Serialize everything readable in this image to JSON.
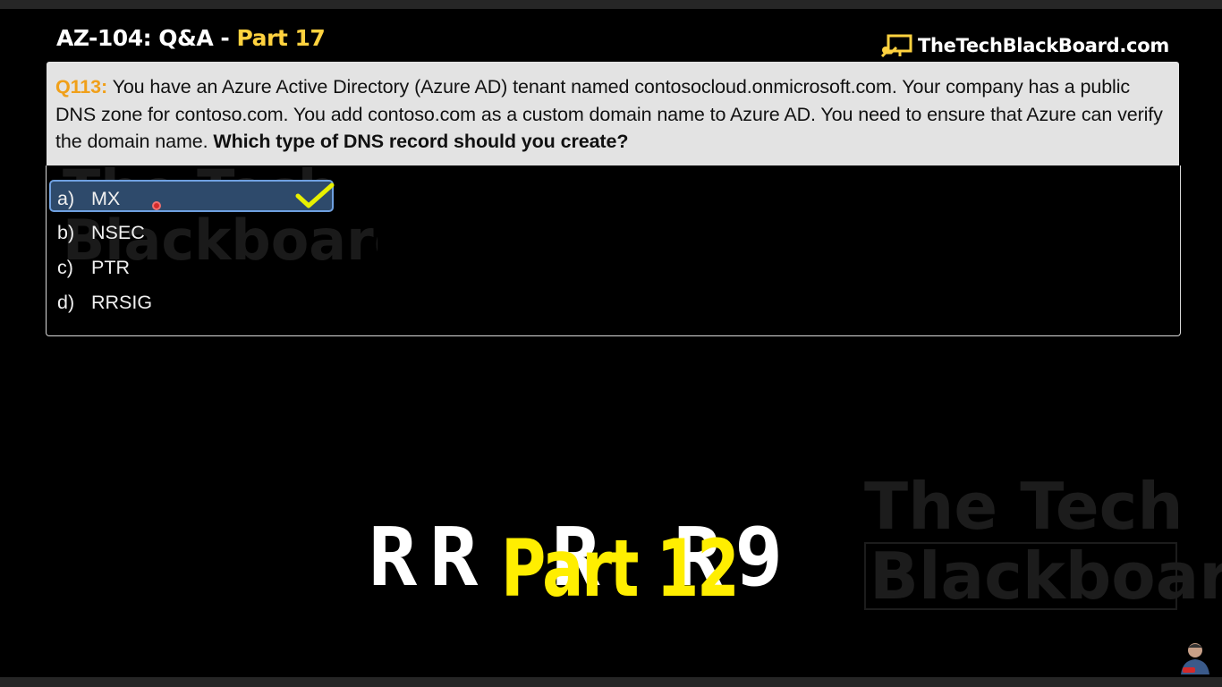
{
  "header": {
    "title_main": "AZ-104: Q&A",
    "title_sep": " - ",
    "title_part": "Part 17",
    "brand": "TheTechBlackBoard.com",
    "brand_icon": "chalkboard-icon"
  },
  "question": {
    "number": "Q113:",
    "text": " You have an Azure Active Directory (Azure AD) tenant named contosocloud.onmicrosoft.com. Your company has a public DNS zone for contoso.com. You add contoso.com as a custom domain name to Azure AD. You need to ensure that Azure can verify the domain name. ",
    "ask": "Which type of DNS record should you create?"
  },
  "options": [
    {
      "letter": "a)",
      "text": "MX",
      "selected": true
    },
    {
      "letter": "b)",
      "text": "NSEC",
      "selected": false
    },
    {
      "letter": "c)",
      "text": "PTR",
      "selected": false
    },
    {
      "letter": "d)",
      "text": "RRSIG",
      "selected": false
    }
  ],
  "watermark": {
    "line1": "The Tech",
    "line2": "Blackboard"
  },
  "overlay": {
    "glitch_text": "RR R R9",
    "part_label": "Part 12"
  },
  "colors": {
    "background": "#000000",
    "question_bg": "#e3e3e3",
    "question_number": "#f0a01a",
    "title_part": "#ffd23f",
    "selected_bg": "#2e4a6b",
    "check": "#e8f000",
    "part12": "#ffee00"
  }
}
